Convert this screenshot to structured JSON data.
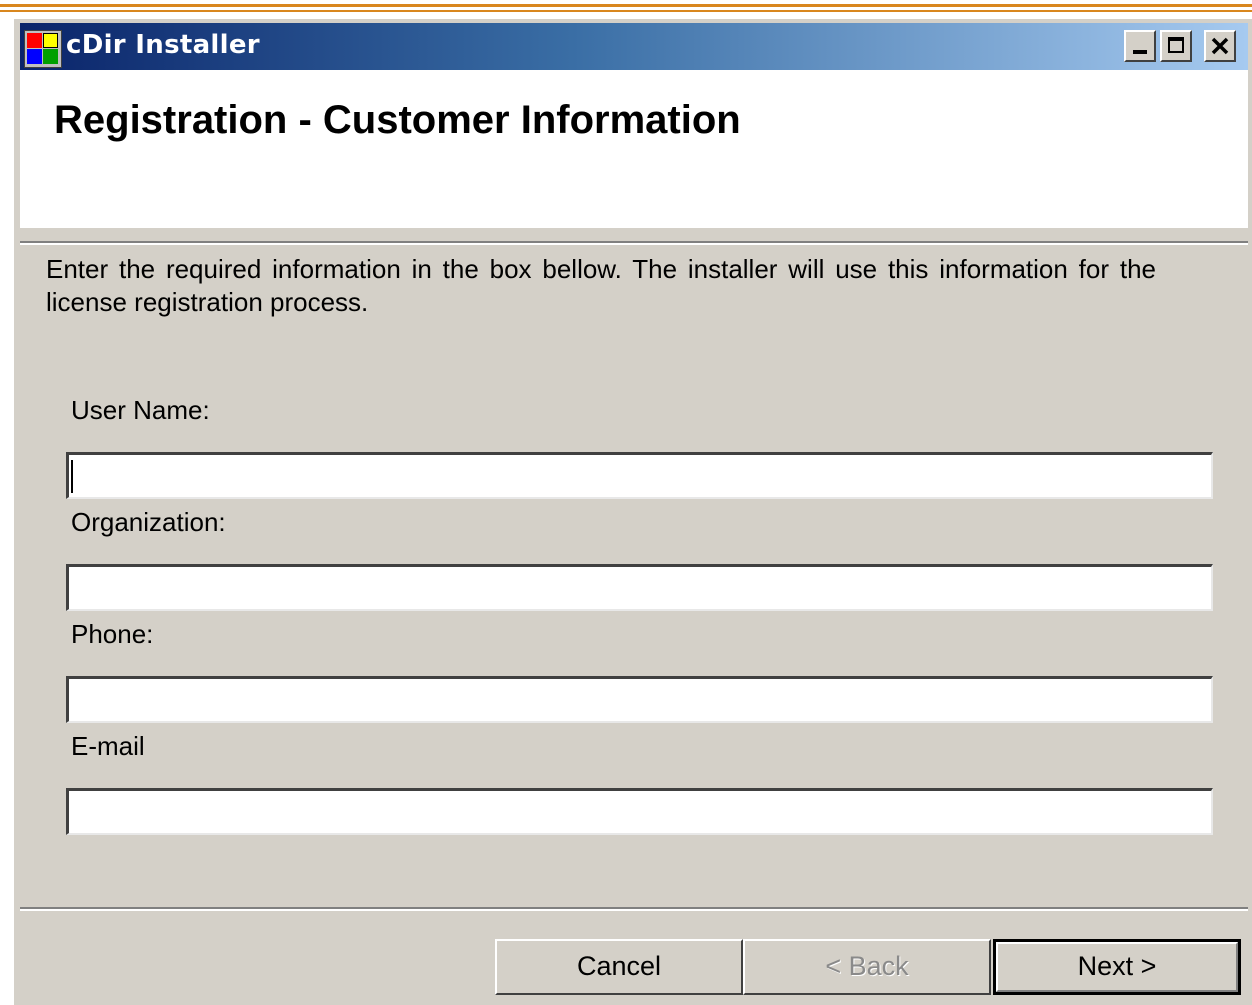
{
  "window": {
    "title": "cDir Installer",
    "title_gradient": [
      "#0a246a",
      "#a6caf0"
    ]
  },
  "header": {
    "title": "Registration - Customer Information"
  },
  "intro": {
    "text": "Enter the required information in the box bellow. The installer will use this  information for the license registration process."
  },
  "form": {
    "user_name_label": "User Name:",
    "user_name_value": "",
    "organization_label": "Organization:",
    "organization_value": "",
    "phone_label": "Phone:",
    "phone_value": "",
    "email_label": "E-mail",
    "email_value": ""
  },
  "buttons": {
    "cancel": "Cancel",
    "back": "< Back",
    "next": "Next >"
  },
  "icons": {
    "app": "app-icon",
    "minimize": "minimize-icon",
    "maximize": "maximize-icon",
    "close": "close-icon"
  }
}
